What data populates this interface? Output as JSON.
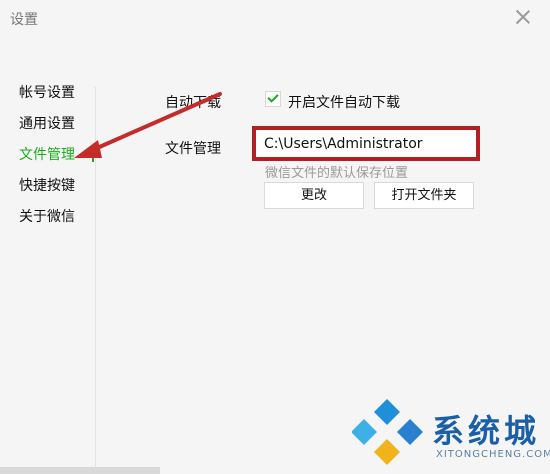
{
  "window": {
    "title": "设置"
  },
  "nav": {
    "items": [
      {
        "label": "帐号设置"
      },
      {
        "label": "通用设置"
      },
      {
        "label": "文件管理"
      },
      {
        "label": "快捷按键"
      },
      {
        "label": "关于微信"
      }
    ],
    "active_index": 2
  },
  "auto_download": {
    "label": "自动下载",
    "checkbox_label": "开启文件自动下载",
    "checked": true
  },
  "file_manage": {
    "label": "文件管理",
    "path_value": "C:\\Users\\Administrator",
    "hint": "微信文件的默认保存位置",
    "change_button": "更改",
    "open_folder_button": "打开文件夹"
  },
  "watermark": {
    "brand": "系统城",
    "site": "XITONGCHENG.COM"
  },
  "colors": {
    "accent_green": "#1aad19",
    "highlight_red": "#b22020",
    "watermark_blue": "#1b5fa8"
  }
}
